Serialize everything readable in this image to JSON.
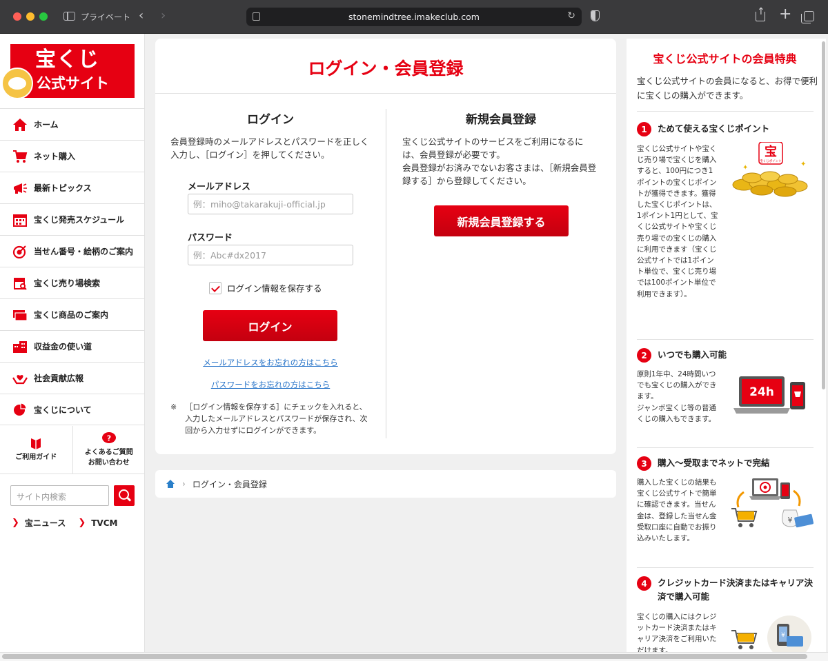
{
  "browser": {
    "private_label": "プライベート",
    "url": "stonemindtree.imakeclub.com"
  },
  "logo": {
    "line1": "宝くじ",
    "line2": "公式サイト"
  },
  "sidebar": {
    "items": [
      {
        "label": "ホーム",
        "icon": "home-icon"
      },
      {
        "label": "ネット購入",
        "icon": "cart-icon"
      },
      {
        "label": "最新トピックス",
        "icon": "megaphone-icon"
      },
      {
        "label": "宝くじ発売スケジュール",
        "icon": "calendar-icon"
      },
      {
        "label": "当せん番号・絵柄のご案内",
        "icon": "target-icon"
      },
      {
        "label": "宝くじ売り場検索",
        "icon": "shop-icon"
      },
      {
        "label": "宝くじ商品のご案内",
        "icon": "tickets-icon"
      },
      {
        "label": "収益金の使い道",
        "icon": "building-icon"
      },
      {
        "label": "社会貢献広報",
        "icon": "heart-hands-icon"
      },
      {
        "label": "宝くじについて",
        "icon": "pie-icon"
      }
    ],
    "guide_label": "ご利用ガイド",
    "faq_label": "よくあるご質問\nお問い合わせ",
    "search_placeholder": "サイト内検索",
    "links": [
      "宝ニュース",
      "TVCM"
    ]
  },
  "main": {
    "title": "ログイン・会員登録",
    "login": {
      "heading": "ログイン",
      "description": "会員登録時のメールアドレスとパスワードを正しく入力し、［ログイン］を押してください。",
      "email_label": "メールアドレス",
      "email_placeholder": "例：miho@takarakuji-official.jp",
      "password_label": "パスワード",
      "password_placeholder": "例：Abc#dx2017",
      "remember_label": "ログイン情報を保存する",
      "remember_checked": true,
      "button": "ログイン",
      "forgot_email": "メールアドレスをお忘れの方はこちら",
      "forgot_password": "パスワードをお忘れの方はこちら",
      "note_mark": "※",
      "note": "［ログイン情報を保存する］にチェックを入れると、入力したメールアドレスとパスワードが保存され、次回から入力せずにログインができます。"
    },
    "register": {
      "heading": "新規会員登録",
      "description": "宝くじ公式サイトのサービスをご利用になるには、会員登録が必要です。\n会員登録がお済みでないお客さまは、［新規会員登録する］から登録してください。",
      "button": "新規会員登録する"
    }
  },
  "breadcrumb": {
    "current": "ログイン・会員登録"
  },
  "benefits": {
    "title": "宝くじ公式サイトの会員特典",
    "intro": "宝くじ公式サイトの会員になると、お得で便利に宝くじの購入ができます。",
    "items": [
      {
        "num": "1",
        "title": "ためて使える宝くじポイント",
        "text": "宝くじ公式サイトや宝くじ売り場で宝くじを購入すると、100円につき1ポイントの宝くじポイントが獲得できます。獲得した宝くじポイントは、1ポイント1円として、宝くじ公式サイトや宝くじ売り場での宝くじの購入に利用できます（宝くじ公式サイトでは1ポイント単位で、宝くじ売り場では100ポイント単位で利用できます）。",
        "badge": "宝くじポイント"
      },
      {
        "num": "2",
        "title": "いつでも購入可能",
        "text": "原則1年中、24時間いつでも宝くじの購入ができます。\nジャンボ宝くじ等の普通くじの購入もできます。",
        "badge": "24h"
      },
      {
        "num": "3",
        "title": "購入〜受取までネットで完結",
        "text": "購入した宝くじの結果も宝くじ公式サイトで簡単に確認できます。当せん金は、登録した当せん金受取口座に自動でお振り込みいたします。"
      },
      {
        "num": "4",
        "title": "クレジットカード決済またはキャリア決済で購入可能",
        "text": "宝くじの購入にはクレジットカード決済またはキャリア決済をご利用いただけます。"
      }
    ]
  },
  "colors": {
    "brand_red": "#e60012",
    "link_blue": "#2673c8"
  }
}
